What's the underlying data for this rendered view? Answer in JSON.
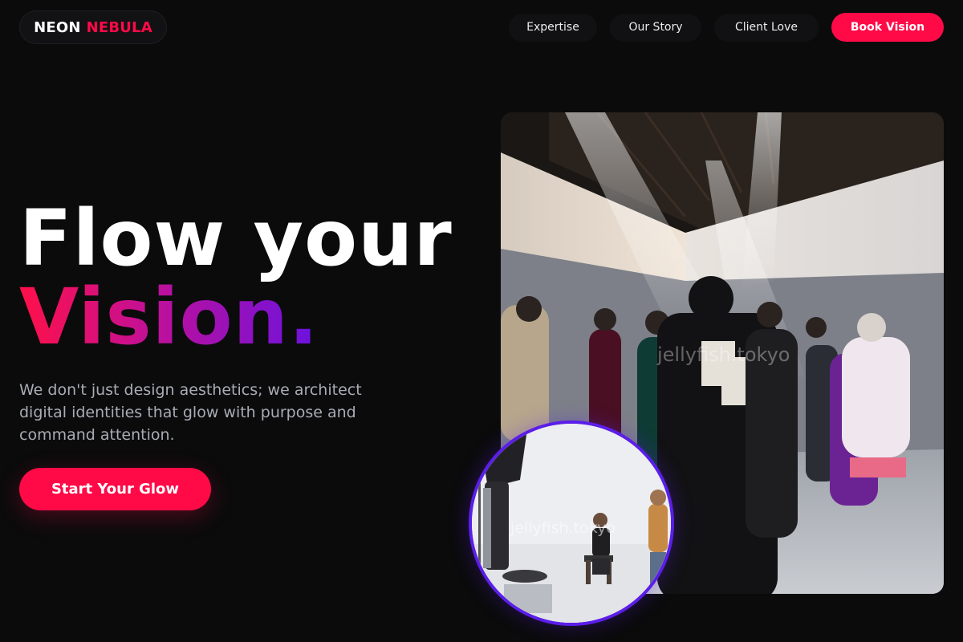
{
  "brand": {
    "word1": "NEON",
    "word2": "NEBULA"
  },
  "nav": {
    "items": [
      "Expertise",
      "Our Story",
      "Client Love"
    ],
    "cta": "Book Vision"
  },
  "hero": {
    "headline_line1": "Flow your",
    "headline_line2": "Vision.",
    "subcopy": "We don't just design aesthetics; we architect digital identities that glow with purpose and command attention.",
    "cta": "Start Your Glow"
  },
  "images": {
    "main_watermark": "jellyfish.tokyo",
    "inset_watermark": "jellyfish.tokyo"
  },
  "colors": {
    "accent": "#ff0a47",
    "gradient_start": "#ff1048",
    "gradient_end": "#6a12e0",
    "inset_ring": "#5b1ee8",
    "background": "#0b0b0c"
  }
}
